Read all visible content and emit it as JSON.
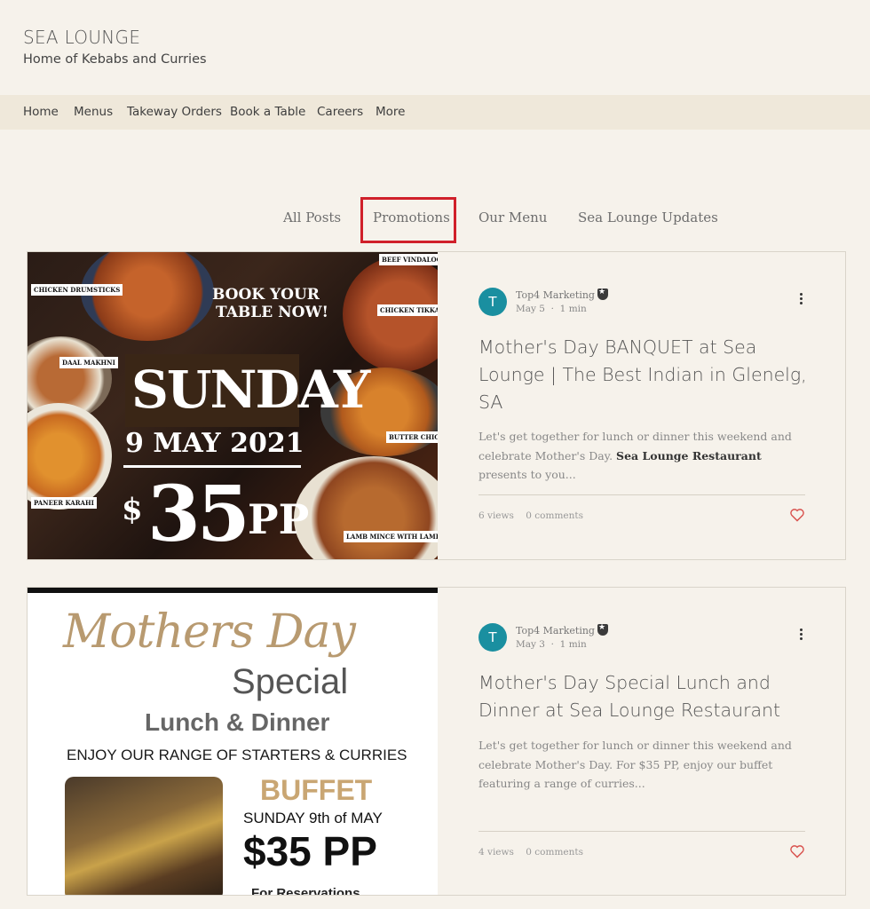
{
  "site": {
    "title": "SEA LOUNGE",
    "tagline": "Home of Kebabs and Curries"
  },
  "nav": {
    "items": [
      {
        "label": "Home"
      },
      {
        "label": "Menus"
      },
      {
        "label": "Takeway Orders"
      },
      {
        "label": "Book a Table"
      },
      {
        "label": "Careers"
      },
      {
        "label": "More"
      }
    ]
  },
  "categories": {
    "items": [
      {
        "label": "All Posts"
      },
      {
        "label": "Promotions"
      },
      {
        "label": "Our Menu"
      },
      {
        "label": "Sea Lounge Updates"
      }
    ],
    "highlight_color": "#d0202a"
  },
  "posts": [
    {
      "avatar_letter": "T",
      "author": "Top4 Marketing",
      "date": "May 5",
      "read_time": "1 min",
      "title": "Mother's Day BANQUET at Sea Lounge | The Best Indian in Glenelg, SA",
      "excerpt_pre": "Let's get together for lunch or dinner this weekend and celebrate Mother's Day. ",
      "excerpt_bold": "Sea Lounge Restaurant",
      "excerpt_post": " presents to you...",
      "views": "6 views",
      "comments": "0 comments",
      "image": {
        "labels": {
          "chicken_drumsticks": "CHICKEN DRUMSTICKS",
          "beef_vindaloo": "BEEF VINDALOO",
          "chicken_tikka": "CHICKEN TIKKA",
          "daal_makhni": "DAAL MAKHNI",
          "butter_chicken": "BUTTER CHICKEN",
          "paneer_karahi": "PANEER KARAHI",
          "lamb_mince": "LAMB MINCE WITH LAMB CHUNKS"
        },
        "book_line1": "BOOK YOUR",
        "book_line2": "TABLE NOW!",
        "day": "SUNDAY",
        "date": "9 MAY 2021",
        "price_prefix": "$",
        "price_amount": "35",
        "price_suffix": "PP"
      }
    },
    {
      "avatar_letter": "T",
      "author": "Top4 Marketing",
      "date": "May 3",
      "read_time": "1 min",
      "title": "Mother's Day Special Lunch and Dinner at Sea Lounge Restaurant",
      "excerpt": "Let's get together for lunch or dinner this weekend and celebrate Mother's Day. For $35 PP, enjoy our buffet featuring a range of curries...",
      "views": "4 views",
      "comments": "0 comments",
      "image": {
        "line_mothers_day": "Mothers Day",
        "line_special": "Special",
        "line_lunch_dinner": "Lunch & Dinner",
        "line_enjoy": "ENJOY OUR RANGE OF STARTERS & CURRIES",
        "line_buffet": "BUFFET",
        "line_sunday": "SUNDAY 9th of MAY",
        "line_price": "$35 PP",
        "line_reservations": "For Reservations"
      }
    }
  ],
  "colors": {
    "background": "#f6f2eb",
    "nav_background": "#efe8da",
    "avatar": "#1a8fa0",
    "heart": "#d9534f"
  }
}
